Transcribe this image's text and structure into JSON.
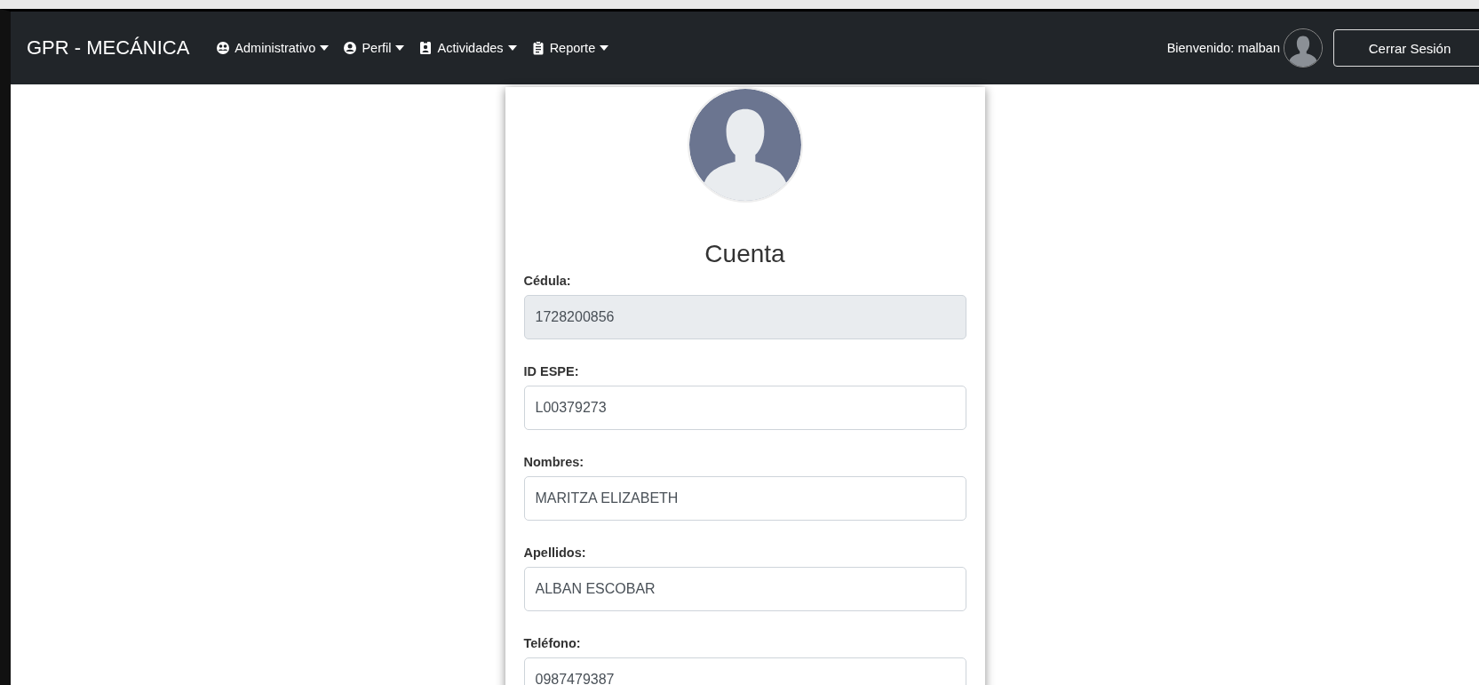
{
  "navbar": {
    "brand": "GPR - MECÁNICA",
    "menus": [
      {
        "label": "Administrativo",
        "kind": "admin"
      },
      {
        "label": "Perfil",
        "kind": "user"
      },
      {
        "label": "Actividades",
        "kind": "badge"
      },
      {
        "label": "Reporte",
        "kind": "clipboard"
      }
    ],
    "welcome": "Bienvenido: malban",
    "logout": "Cerrar Sesión"
  },
  "card": {
    "title": "Cuenta",
    "fields": [
      {
        "label": "Cédula:",
        "value": "1728200856",
        "disabled": true
      },
      {
        "label": "ID ESPE:",
        "value": "L00379273",
        "disabled": false
      },
      {
        "label": "Nombres:",
        "value": "MARITZA ELIZABETH",
        "disabled": false
      },
      {
        "label": "Apellidos:",
        "value": "ALBAN ESCOBAR",
        "disabled": false
      },
      {
        "label": "Teléfono:",
        "value": "0987479387",
        "disabled": false
      }
    ]
  }
}
